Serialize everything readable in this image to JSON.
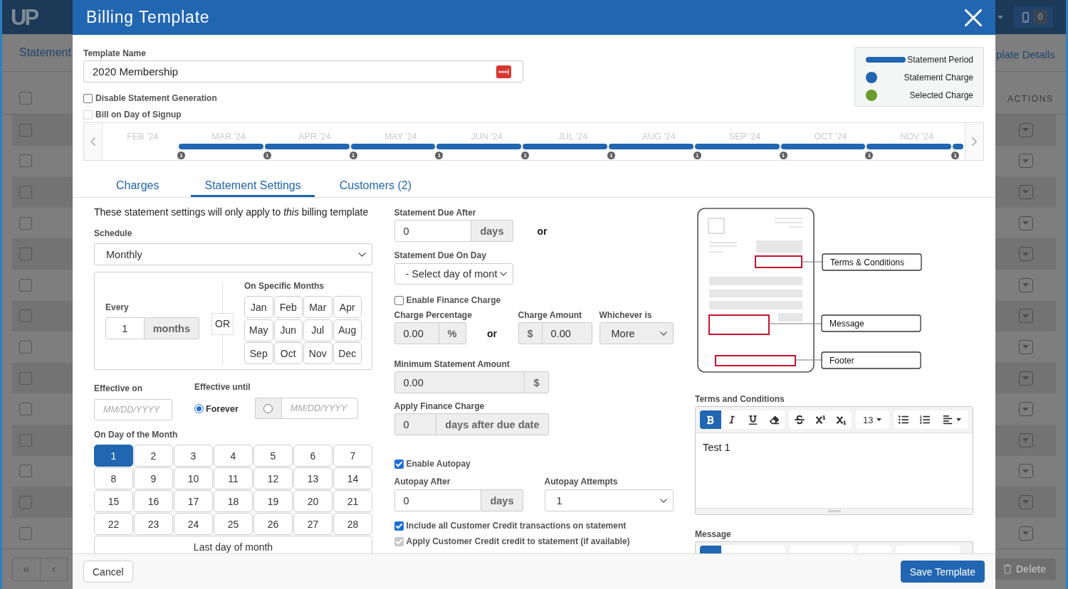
{
  "background": {
    "logo": "UP",
    "section_title": "Statement",
    "detail_tab": "plate Details",
    "actions_header": "ACTIONS",
    "badge_count": "0",
    "select_all": {
      "checked": false
    },
    "rows": [
      {
        "checked": false
      },
      {
        "checked": false
      },
      {
        "checked": false
      },
      {
        "checked": false
      },
      {
        "checked": false
      },
      {
        "checked": false
      },
      {
        "checked": false
      },
      {
        "checked": false
      },
      {
        "checked": false
      },
      {
        "checked": false
      },
      {
        "checked": false
      },
      {
        "checked": false
      },
      {
        "checked": false
      },
      {
        "checked": false
      }
    ],
    "pager": [
      {
        "kind": "first",
        "label": "«"
      },
      {
        "kind": "previous",
        "label": "‹"
      }
    ],
    "delete_label": "Delete"
  },
  "modal": {
    "title": "Billing Template",
    "template_name": {
      "label": "Template Name",
      "value": "2020 Membership"
    },
    "options": [
      {
        "label": "Disable Statement Generation",
        "checked": false,
        "disabled": false
      },
      {
        "label": "Bill on Day of Signup",
        "checked": false,
        "disabled": true
      }
    ],
    "legend": [
      {
        "kind": "period",
        "label": "Statement Period",
        "color": "#2166b0"
      },
      {
        "kind": "dot",
        "label": "Statement Charge",
        "color": "#2166b0"
      },
      {
        "kind": "dot",
        "label": "Selected Charge",
        "color": "#6a9c2e"
      }
    ],
    "timeline": {
      "months": [
        "FEB '24",
        "MAR '24",
        "APR '24",
        "MAY '24",
        "JUN '24",
        "JUL '24",
        "AUG '24",
        "SEP '24",
        "OCT '24",
        "NOV '24"
      ],
      "periods": [
        {
          "count": "1"
        },
        {
          "count": "1"
        },
        {
          "count": "1"
        },
        {
          "count": "1"
        },
        {
          "count": "1"
        },
        {
          "count": "1"
        },
        {
          "count": "1"
        },
        {
          "count": "1"
        },
        {
          "count": "1"
        },
        {
          "count": "1"
        }
      ]
    },
    "tabs": [
      {
        "label": "Charges",
        "selected": false
      },
      {
        "label": "Statement Settings",
        "selected": true
      },
      {
        "label": "Customers (2)",
        "selected": false
      }
    ],
    "intro": "These statement settings will only apply to *this* billing template",
    "schedule": {
      "label": "Schedule",
      "value": "Monthly"
    },
    "recurrence": {
      "every_label": "Every",
      "every_value": "1",
      "every_unit": "months",
      "or_label": "OR",
      "months_label": "On Specific Months",
      "months": [
        {
          "label": "Jan",
          "selected": false
        },
        {
          "label": "Feb",
          "selected": false
        },
        {
          "label": "Mar",
          "selected": false
        },
        {
          "label": "Apr",
          "selected": false
        },
        {
          "label": "May",
          "selected": false
        },
        {
          "label": "Jun",
          "selected": false
        },
        {
          "label": "Jul",
          "selected": false
        },
        {
          "label": "Aug",
          "selected": false
        },
        {
          "label": "Sep",
          "selected": false
        },
        {
          "label": "Oct",
          "selected": false
        },
        {
          "label": "Nov",
          "selected": false
        },
        {
          "label": "Dec",
          "selected": false
        }
      ]
    },
    "effective_on": {
      "label": "Effective on",
      "placeholder": "MM/DD/YYYY"
    },
    "effective_until": {
      "label": "Effective until",
      "options": [
        {
          "kind": "forever",
          "label": "Forever",
          "selected": true
        },
        {
          "kind": "date",
          "placeholder": "MM/DD/YYYY",
          "selected": false
        }
      ]
    },
    "day_of_month": {
      "label": "On Day of the Month",
      "days": [
        {
          "label": "1",
          "selected": true
        },
        {
          "label": "2",
          "selected": false
        },
        {
          "label": "3",
          "selected": false
        },
        {
          "label": "4",
          "selected": false
        },
        {
          "label": "5",
          "selected": false
        },
        {
          "label": "6",
          "selected": false
        },
        {
          "label": "7",
          "selected": false
        },
        {
          "label": "8",
          "selected": false
        },
        {
          "label": "9",
          "selected": false
        },
        {
          "label": "10",
          "selected": false
        },
        {
          "label": "11",
          "selected": false
        },
        {
          "label": "12",
          "selected": false
        },
        {
          "label": "13",
          "selected": false
        },
        {
          "label": "14",
          "selected": false
        },
        {
          "label": "15",
          "selected": false
        },
        {
          "label": "16",
          "selected": false
        },
        {
          "label": "17",
          "selected": false
        },
        {
          "label": "18",
          "selected": false
        },
        {
          "label": "19",
          "selected": false
        },
        {
          "label": "20",
          "selected": false
        },
        {
          "label": "21",
          "selected": false
        },
        {
          "label": "22",
          "selected": false
        },
        {
          "label": "23",
          "selected": false
        },
        {
          "label": "24",
          "selected": false
        },
        {
          "label": "25",
          "selected": false
        },
        {
          "label": "26",
          "selected": false
        },
        {
          "label": "27",
          "selected": false
        },
        {
          "label": "28",
          "selected": false
        }
      ],
      "last_day": {
        "label": "Last day of month",
        "selected": false
      }
    },
    "due_after": {
      "label": "Statement Due After",
      "value": "0",
      "unit": "days",
      "disabled": false,
      "or": "or"
    },
    "due_on_day": {
      "label": "Statement Due On Day",
      "value": "- Select day of mont"
    },
    "finance": {
      "enable": {
        "label": "Enable Finance Charge",
        "checked": false
      },
      "percentage": {
        "label": "Charge Percentage",
        "value": "0.00",
        "unit": "%",
        "disabled": true
      },
      "or": "or",
      "amount": {
        "label": "Charge Amount",
        "prefix": "$",
        "value": "0.00",
        "disabled": true
      },
      "whichever": {
        "label": "Whichever is",
        "value": "More",
        "disabled": true
      },
      "minimum": {
        "label": "Minimum Statement Amount",
        "value": "0.00",
        "unit": "$",
        "disabled": true
      },
      "apply": {
        "label": "Apply Finance Charge",
        "value": "0",
        "unit": "days after due date",
        "disabled": true
      }
    },
    "autopay": {
      "enable": {
        "label": "Enable Autopay",
        "checked": true
      },
      "after": {
        "label": "Autopay After",
        "value": "0",
        "unit": "days",
        "disabled": false
      },
      "attempts": {
        "label": "Autopay Attempts",
        "value": "1",
        "disabled": false
      }
    },
    "credit_options": [
      {
        "label": "Include all Customer Credit transactions on statement",
        "checked": true,
        "disabled": false
      },
      {
        "label": "Apply Customer Credit credit to statement (if available)",
        "checked": true,
        "disabled": true
      }
    ],
    "preview": {
      "callouts": [
        {
          "kind": "terms",
          "label": "Terms & Conditions"
        },
        {
          "kind": "message",
          "label": "Message"
        },
        {
          "kind": "footer",
          "label": "Footer"
        }
      ]
    },
    "editors": [
      {
        "label": "Terms and Conditions",
        "content": "Test 1",
        "toolbar": [
          {
            "items": [
              {
                "kind": "bold",
                "active": true
              },
              {
                "kind": "italic",
                "active": false
              },
              {
                "kind": "underline",
                "active": false
              },
              {
                "kind": "eraser",
                "active": false
              }
            ]
          },
          {
            "items": [
              {
                "kind": "strikethrough",
                "active": false
              },
              {
                "kind": "superscript",
                "active": false
              },
              {
                "kind": "subscript",
                "active": false
              }
            ]
          },
          {
            "items": [
              {
                "kind": "font_size",
                "label": "13",
                "active": false
              }
            ]
          },
          {
            "items": [
              {
                "kind": "bullets",
                "active": false
              },
              {
                "kind": "numbered",
                "active": false
              },
              {
                "kind": "align",
                "active": false
              }
            ]
          }
        ]
      },
      {
        "label": "Message",
        "toolbar": [
          {
            "items": [
              {
                "active": true
              },
              {
                "active": false
              },
              {
                "active": false
              },
              {
                "active": false
              }
            ]
          },
          {
            "items": [
              {
                "active": false
              },
              {
                "active": false
              },
              {
                "active": false
              }
            ]
          },
          {
            "items": [
              {
                "active": false
              }
            ]
          },
          {
            "items": [
              {
                "active": false
              },
              {
                "active": false
              },
              {
                "active": false
              }
            ]
          }
        ]
      }
    ],
    "footer": {
      "cancel": "Cancel",
      "save": "Save Template"
    }
  }
}
